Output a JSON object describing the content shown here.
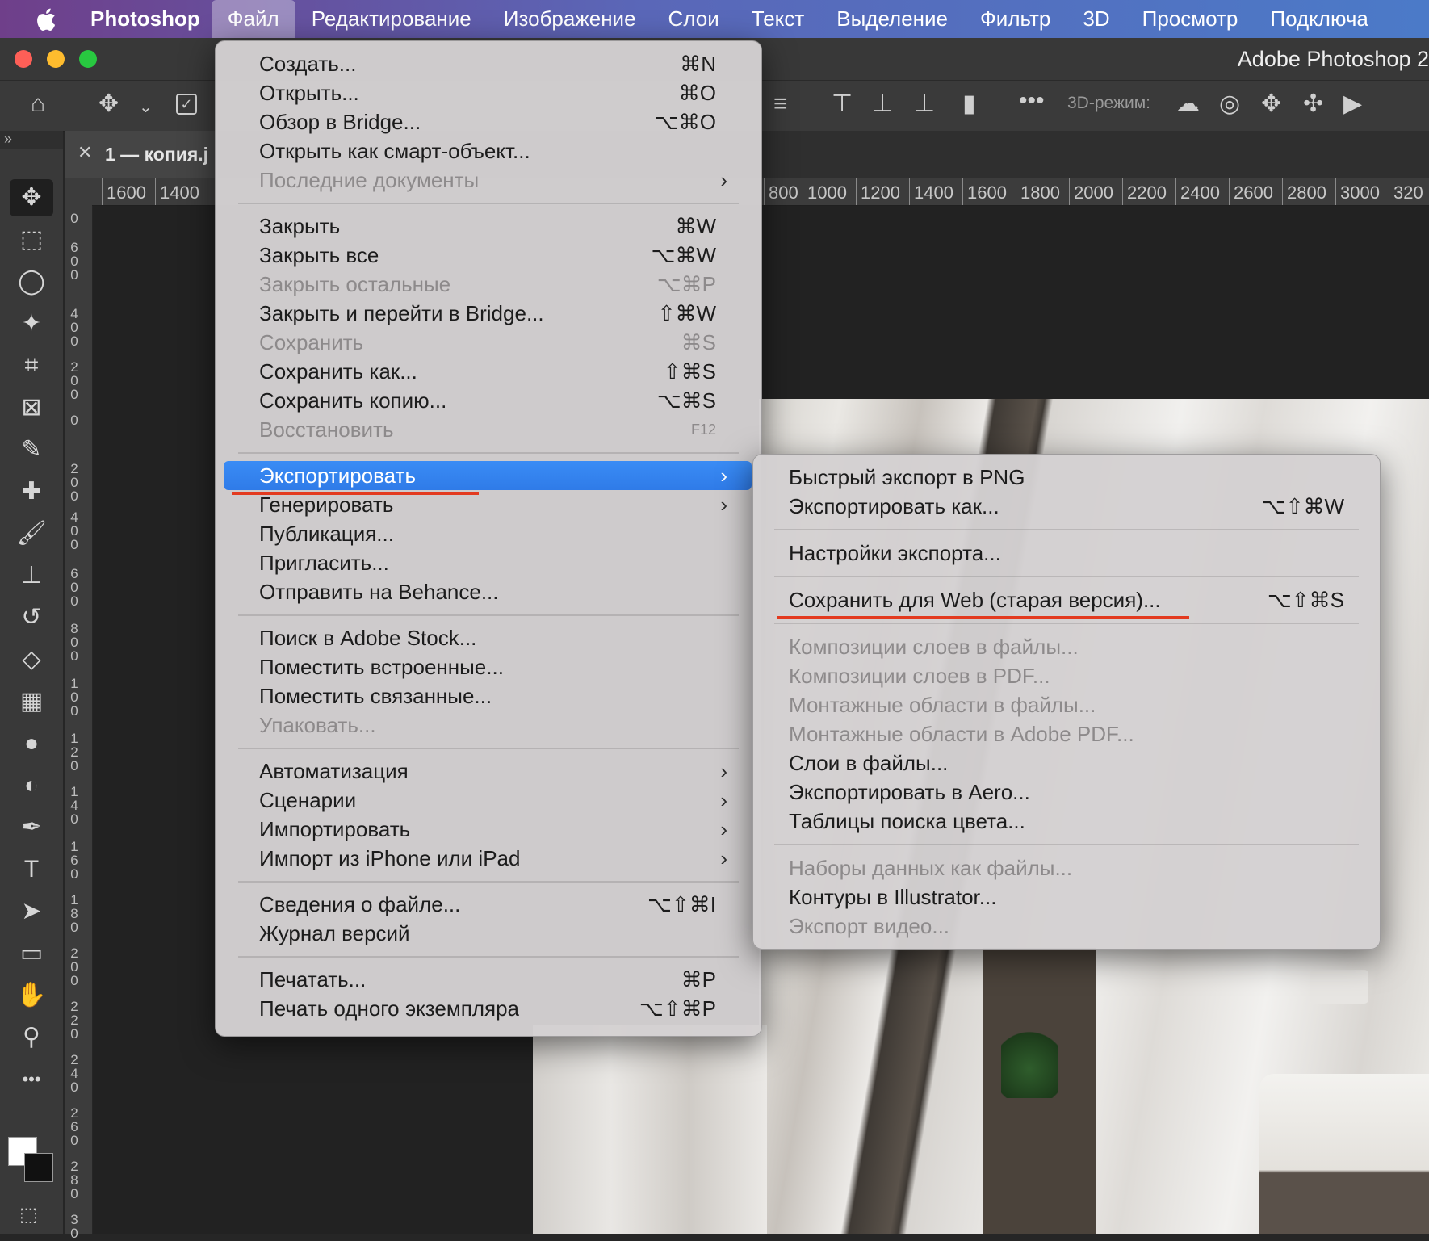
{
  "menubar": {
    "app": "Photoshop",
    "items": [
      "Файл",
      "Редактирование",
      "Изображение",
      "Слои",
      "Текст",
      "Выделение",
      "Фильтр",
      "3D",
      "Просмотр",
      "Подключа"
    ]
  },
  "window": {
    "title": "Adobe Photoshop 2"
  },
  "optionsbar": {
    "mode3d": "3D-режим:"
  },
  "document": {
    "tab": "1 — копия.j"
  },
  "ruler": {
    "h_ticks": [
      "1600",
      "1400",
      "800",
      "1000",
      "1200",
      "1400",
      "1600",
      "1800",
      "2000",
      "2200",
      "2400",
      "2600",
      "2800",
      "3000",
      "320"
    ],
    "v_ticks": [
      "0",
      "600",
      "400",
      "200",
      "0",
      "200",
      "400",
      "600",
      "800",
      "100",
      "120",
      "140",
      "160",
      "180",
      "200",
      "220",
      "240",
      "260",
      "280",
      "30"
    ]
  },
  "file_menu": {
    "items": [
      {
        "label": "Создать...",
        "shortcut": "⌘N",
        "disabled": false
      },
      {
        "label": "Открыть...",
        "shortcut": "⌘O",
        "disabled": false
      },
      {
        "label": "Обзор в Bridge...",
        "shortcut": "⌥⌘O",
        "disabled": false
      },
      {
        "label": "Открыть как смарт-объект...",
        "shortcut": "",
        "disabled": false
      },
      {
        "label": "Последние документы",
        "shortcut": "",
        "disabled": true,
        "submenu": true
      },
      {
        "label": "Закрыть",
        "shortcut": "⌘W",
        "disabled": false
      },
      {
        "label": "Закрыть все",
        "shortcut": "⌥⌘W",
        "disabled": false
      },
      {
        "label": "Закрыть остальные",
        "shortcut": "⌥⌘P",
        "disabled": true
      },
      {
        "label": "Закрыть и перейти в Bridge...",
        "shortcut": "⇧⌘W",
        "disabled": false
      },
      {
        "label": "Сохранить",
        "shortcut": "⌘S",
        "disabled": true
      },
      {
        "label": "Сохранить как...",
        "shortcut": "⇧⌘S",
        "disabled": false
      },
      {
        "label": "Сохранить копию...",
        "shortcut": "⌥⌘S",
        "disabled": false
      },
      {
        "label": "Восстановить",
        "shortcut": "F12",
        "disabled": true
      },
      {
        "label": "Экспортировать",
        "shortcut": "",
        "disabled": false,
        "submenu": true,
        "highlighted": true
      },
      {
        "label": "Генерировать",
        "shortcut": "",
        "disabled": false,
        "submenu": true
      },
      {
        "label": "Публикация...",
        "shortcut": "",
        "disabled": false
      },
      {
        "label": "Пригласить...",
        "shortcut": "",
        "disabled": false
      },
      {
        "label": "Отправить на Behance...",
        "shortcut": "",
        "disabled": false
      },
      {
        "label": "Поиск в Adobe Stock...",
        "shortcut": "",
        "disabled": false
      },
      {
        "label": "Поместить встроенные...",
        "shortcut": "",
        "disabled": false
      },
      {
        "label": "Поместить связанные...",
        "shortcut": "",
        "disabled": false
      },
      {
        "label": "Упаковать...",
        "shortcut": "",
        "disabled": true
      },
      {
        "label": "Автоматизация",
        "shortcut": "",
        "disabled": false,
        "submenu": true
      },
      {
        "label": "Сценарии",
        "shortcut": "",
        "disabled": false,
        "submenu": true
      },
      {
        "label": "Импортировать",
        "shortcut": "",
        "disabled": false,
        "submenu": true
      },
      {
        "label": "Импорт из iPhone или iPad",
        "shortcut": "",
        "disabled": false,
        "submenu": true
      },
      {
        "label": "Сведения о файле...",
        "shortcut": "⌥⇧⌘I",
        "disabled": false
      },
      {
        "label": "Журнал версий",
        "shortcut": "",
        "disabled": false
      },
      {
        "label": "Печатать...",
        "shortcut": "⌘P",
        "disabled": false
      },
      {
        "label": "Печать одного экземпляра",
        "shortcut": "⌥⇧⌘P",
        "disabled": false
      }
    ]
  },
  "export_submenu": {
    "items": [
      {
        "label": "Быстрый экспорт в PNG",
        "shortcut": "",
        "disabled": false
      },
      {
        "label": "Экспортировать как...",
        "shortcut": "⌥⇧⌘W",
        "disabled": false
      },
      {
        "label": "Настройки экспорта...",
        "shortcut": "",
        "disabled": false
      },
      {
        "label": "Сохранить для Web (старая версия)...",
        "shortcut": "⌥⇧⌘S",
        "disabled": false
      },
      {
        "label": "Композиции слоев в файлы...",
        "shortcut": "",
        "disabled": true
      },
      {
        "label": "Композиции слоев в PDF...",
        "shortcut": "",
        "disabled": true
      },
      {
        "label": "Монтажные области в файлы...",
        "shortcut": "",
        "disabled": true
      },
      {
        "label": "Монтажные области в Adobe PDF...",
        "shortcut": "",
        "disabled": true
      },
      {
        "label": "Слои в файлы...",
        "shortcut": "",
        "disabled": false
      },
      {
        "label": "Экспортировать в Aero...",
        "shortcut": "",
        "disabled": false
      },
      {
        "label": "Таблицы поиска цвета...",
        "shortcut": "",
        "disabled": false
      },
      {
        "label": "Наборы данных как файлы...",
        "shortcut": "",
        "disabled": true
      },
      {
        "label": "Контуры в Illustrator...",
        "shortcut": "",
        "disabled": false
      },
      {
        "label": "Экспорт видео...",
        "shortcut": "",
        "disabled": true
      }
    ]
  },
  "tools": [
    "move-tool",
    "marquee-tool",
    "lasso-tool",
    "magic-wand-tool",
    "crop-tool",
    "frame-tool",
    "eyedropper-tool",
    "healing-brush-tool",
    "brush-tool",
    "clone-stamp-tool",
    "history-brush-tool",
    "eraser-tool",
    "gradient-tool",
    "blur-tool",
    "dodge-tool",
    "pen-tool",
    "type-tool",
    "path-selection-tool",
    "rectangle-tool",
    "hand-tool",
    "zoom-tool",
    "more-tools"
  ],
  "colors": {
    "highlight": "#3a8cf5",
    "annotation_red": "#e33a1f",
    "traffic_red": "#fe5f57",
    "traffic_yellow": "#febc2e",
    "traffic_green": "#28c840"
  }
}
